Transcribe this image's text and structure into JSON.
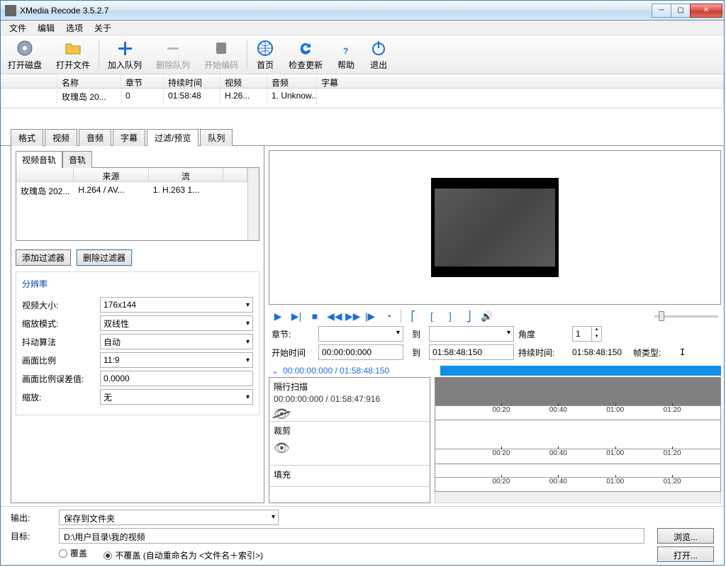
{
  "title": "XMedia Recode 3.5.2.7",
  "menu": [
    "文件",
    "编辑",
    "选项",
    "关于"
  ],
  "toolbar": [
    {
      "label": "打开磁盘",
      "icon": "disc"
    },
    {
      "label": "打开文件",
      "icon": "folder"
    },
    {
      "label": "加入队列",
      "icon": "plus"
    },
    {
      "label": "删除队列",
      "icon": "minus",
      "disabled": true
    },
    {
      "label": "开始编码",
      "icon": "encode",
      "disabled": true
    },
    {
      "label": "首页",
      "icon": "globe"
    },
    {
      "label": "检查更新",
      "icon": "refresh"
    },
    {
      "label": "帮助",
      "icon": "help"
    },
    {
      "label": "退出",
      "icon": "power"
    }
  ],
  "filegrid": {
    "headers": [
      "名称",
      "章节",
      "持续时间",
      "视频",
      "音频",
      "字幕"
    ],
    "row": {
      "name": "玫瑰岛 20...",
      "chapter": "0",
      "duration": "01:58:48",
      "video": "H.26...",
      "audio": "1. Unknow...",
      "sub": ""
    }
  },
  "tabs": [
    "格式",
    "视频",
    "音频",
    "字幕",
    "过滤/预览",
    "队列"
  ],
  "activeTab": "过滤/预览",
  "subtabs": [
    "视频音轨",
    "音轨"
  ],
  "trackgrid": {
    "headers": [
      "",
      "来源",
      "流",
      ""
    ],
    "row": {
      "c0": "玫瑰岛 202...",
      "c1": "H.264 / AV...",
      "c2": "1. H.263 1..."
    }
  },
  "filterButtons": {
    "add": "添加过滤器",
    "del": "删除过滤器"
  },
  "groupTitle": "分辨率",
  "form": {
    "videoSize": {
      "label": "视频大小:",
      "value": "176x144"
    },
    "scaleMode": {
      "label": "缩放模式:",
      "value": "双线性"
    },
    "dither": {
      "label": "抖动算法",
      "value": "自动"
    },
    "aspect": {
      "label": "画面比例",
      "value": "11:9"
    },
    "aspectErr": {
      "label": "画面比例误差值:",
      "value": "0.0000"
    },
    "zoom": {
      "label": "缩放:",
      "value": "无"
    }
  },
  "play": {
    "chapterLabel": "章节:",
    "toLabel": "到",
    "angleLabel": "角度",
    "angleValue": "1",
    "startLabel": "开始时间",
    "startValue": "00:00:00:000",
    "endValue": "01:58:48:150",
    "durLabel": "持续时间:",
    "durValue": "01:58:48:150",
    "frameTypeLabel": "帧类型:",
    "frameTypeValue": "I",
    "pos": "00:00:00:000 / 01:58:48:150"
  },
  "filters": [
    {
      "title": "隔行扫描",
      "sub": "00:00:00:000 / 01:58:47:916",
      "eye": "off"
    },
    {
      "title": "裁剪",
      "sub": "",
      "eye": "on"
    },
    {
      "title": "填充",
      "sub": "",
      "eye": ""
    }
  ],
  "ticks": [
    "00:20",
    "00:40",
    "01:00",
    "01:20"
  ],
  "output": {
    "outLabel": "输出:",
    "outValue": "保存到文件夹",
    "targetLabel": "目标:",
    "targetValue": "D:\\用户目录\\我的视频",
    "browse": "浏览...",
    "open": "打开...",
    "overwrite": "覆盖",
    "noOverwrite": "不覆盖 (自动重命名为 <文件名＋索引>)"
  }
}
